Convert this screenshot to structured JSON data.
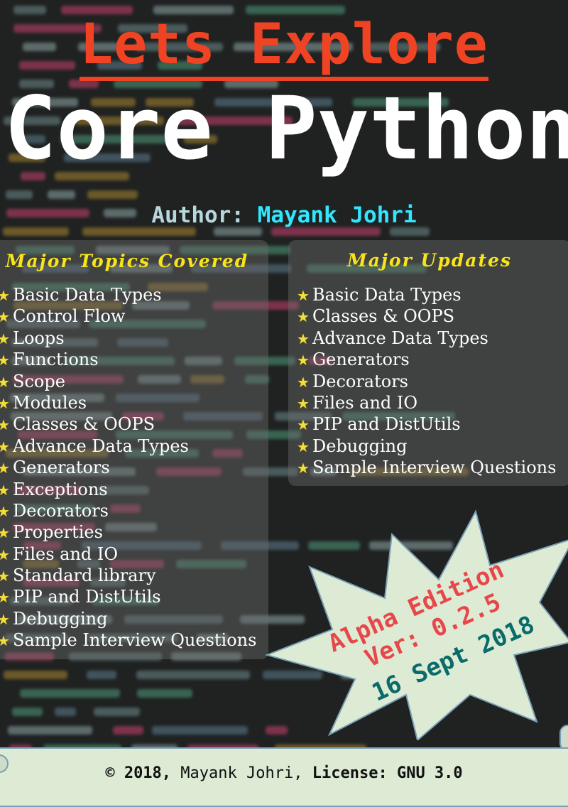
{
  "header": {
    "title_top": "Lets Explore",
    "title_main": "Core Python",
    "author_label": "Author:",
    "author_name": "Mayank Johri"
  },
  "topics": {
    "heading": "Major Topics Covered",
    "items": [
      "Basic Data Types",
      "Control Flow",
      "Loops",
      "Functions",
      "Scope",
      "Modules",
      "Classes & OOPS",
      "Advance Data Types",
      "Generators",
      "Exceptions",
      "Decorators",
      "Properties",
      "Files and IO",
      "Standard library",
      "PIP and DistUtils",
      "Debugging",
      "Sample Interview Questions"
    ]
  },
  "updates": {
    "heading": "Major Updates",
    "items": [
      "Basic Data Types",
      "Classes & OOPS",
      "Advance Data Types",
      "Generators",
      "Decorators",
      "Files and IO",
      "PIP and DistUtils",
      "Debugging",
      "Sample Interview Questions"
    ]
  },
  "badge": {
    "edition": "Alpha Edition",
    "version": "Ver: 0.2.5",
    "date": "16 Sept 2018",
    "edition_color": "#e8474a",
    "date_color": "#0a6b6b",
    "fill": "#ddebd5"
  },
  "footer": {
    "copyright": "© 2018,",
    "author": "Mayank Johri,",
    "license_label": "License:",
    "license": "GNU 3.0"
  },
  "colors": {
    "title_accent": "#ef4323",
    "author_name": "#33e6ff",
    "heading_yellow": "#f7e41b"
  },
  "icons": {
    "bullet": "star-icon"
  }
}
